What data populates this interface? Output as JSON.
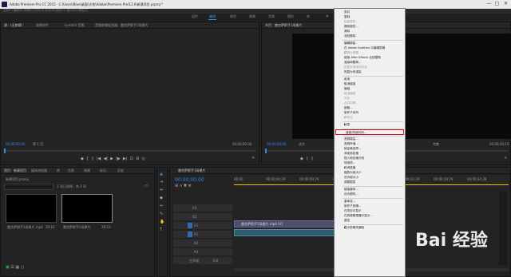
{
  "window": {
    "title": "Adobe Premiere Pro CC 2015 - C:\\Users\\Blue\\桌面\\文档\\Adobe\\Premiere Pro\\12.0\\新建项目.prproj *",
    "minimize": "—",
    "maximize": "□",
    "close": "✕"
  },
  "menubar": {
    "text": "文件(F) 编辑(E) 剪辑(C) 序列(S) 标记(M) 图形(G) 窗口(W) 帮助(H)"
  },
  "workspace_tabs": [
    "组件",
    "编辑",
    "颜色",
    "效果",
    "音频",
    "图形",
    "库"
  ],
  "workspace_more": "»",
  "source_panel": {
    "tabs": [
      "源：(无剪辑)",
      "效果控件",
      "Lumetri 范围",
      "音频剪辑混合器：雷克萨斯手1场景片"
    ],
    "timecode": "00;00;00;00",
    "page": "第 1 页",
    "end_timecode": "00;00;00;00"
  },
  "program_panel": {
    "title": "节目：雷克萨斯手1场景片",
    "timecode": "00;00;00;00",
    "fit": "适合",
    "full": "完整",
    "end_timecode": "00;00;29;10"
  },
  "project_panel": {
    "tabs": [
      "项目：新建项目",
      "媒体浏览器",
      "库",
      "信息",
      "效果",
      "标记",
      "历史"
    ],
    "project_file": "新建项目.prproj",
    "selection": "1 项已选择，共 2 项",
    "items": [
      {
        "name": "雷克萨斯手1场景片.mp4",
        "duration": "29;10"
      },
      {
        "name": "雷克萨斯手1场景片",
        "duration": "29;10"
      }
    ]
  },
  "timeline": {
    "tab": "雷克萨斯手1场景片",
    "timecode": "00;00;00;00",
    "ruler": [
      "00;00",
      "00;00;04;29",
      "00;00;09;29",
      "00;00;14;29",
      "00;00;19;29",
      "00;00;24;29",
      "00;00;29;29",
      "00;00;34;28"
    ],
    "tracks": [
      "V3",
      "V2",
      "V1",
      "A1",
      "A2",
      "A3",
      "主声道"
    ],
    "master_value": "0.0",
    "clip_video": "雷克萨斯手1场景片.mp4 [V]",
    "clip_audio": ""
  },
  "context_menu": {
    "items": [
      {
        "label": "剪切",
        "disabled": false
      },
      {
        "label": "复制",
        "disabled": false
      },
      {
        "label": "粘贴属性...",
        "disabled": true
      },
      {
        "label": "删除属性...",
        "disabled": false
      },
      {
        "label": "清除",
        "disabled": false
      },
      {
        "label": "波纹删除",
        "disabled": false
      },
      {
        "sep": true
      },
      {
        "label": "编辑原始",
        "disabled": false
      },
      {
        "label": "在 Adobe Audition 中编辑剪辑",
        "disabled": false
      },
      {
        "label": "替换为剪辑",
        "disabled": true,
        "submenu": true
      },
      {
        "label": "使用 After Effects 合成替换",
        "disabled": false
      },
      {
        "label": "渲染和替换...",
        "disabled": false
      },
      {
        "label": "恢复未渲染的内容",
        "disabled": true
      },
      {
        "label": "恢复为未渲染",
        "disabled": false
      },
      {
        "sep": true
      },
      {
        "label": "启用",
        "disabled": false,
        "checked": true
      },
      {
        "label": "取消链接",
        "disabled": false
      },
      {
        "label": "编组",
        "disabled": false
      },
      {
        "label": "取消编组",
        "disabled": true
      },
      {
        "label": "同步",
        "disabled": true
      },
      {
        "label": "合并剪辑...",
        "disabled": true
      },
      {
        "label": "嵌套...",
        "disabled": false
      },
      {
        "label": "制作子序列",
        "disabled": false
      },
      {
        "label": "多机位",
        "disabled": true,
        "submenu": true
      },
      {
        "sep": true
      },
      {
        "label": "标签",
        "disabled": false,
        "submenu": true
      },
      {
        "sep": true
      },
      {
        "label": "速度/持续时间...",
        "disabled": false,
        "highlighted": true
      },
      {
        "sep": true
      },
      {
        "label": "音频增益...",
        "disabled": false
      },
      {
        "label": "音频声道...",
        "disabled": false
      },
      {
        "label": "帧定格选项...",
        "disabled": false
      },
      {
        "label": "添加帧定格",
        "disabled": false
      },
      {
        "label": "插入帧定格分段",
        "disabled": false
      },
      {
        "label": "场选项...",
        "disabled": false
      },
      {
        "label": "时间插值",
        "disabled": false,
        "submenu": true
      },
      {
        "label": "缩放为帧大小",
        "disabled": false
      },
      {
        "label": "设为帧大小",
        "disabled": false
      },
      {
        "label": "调整图层",
        "disabled": false
      },
      {
        "sep": true
      },
      {
        "label": "链接媒体...",
        "disabled": false
      },
      {
        "label": "设为脱机...",
        "disabled": false
      },
      {
        "sep": true
      },
      {
        "label": "重命名...",
        "disabled": false
      },
      {
        "label": "制作子剪辑...",
        "disabled": false
      },
      {
        "label": "在项目中显示",
        "disabled": false
      },
      {
        "label": "在资源管理器中显示...",
        "disabled": false
      },
      {
        "label": "属性",
        "disabled": false
      },
      {
        "sep": true
      },
      {
        "label": "显示剪辑关键帧",
        "disabled": false,
        "submenu": true
      }
    ]
  },
  "watermark": "Bai 经验",
  "colors": {
    "accent": "#2d8ceb",
    "highlight_border": "#d4121a",
    "clip": "#4d4d6e"
  }
}
